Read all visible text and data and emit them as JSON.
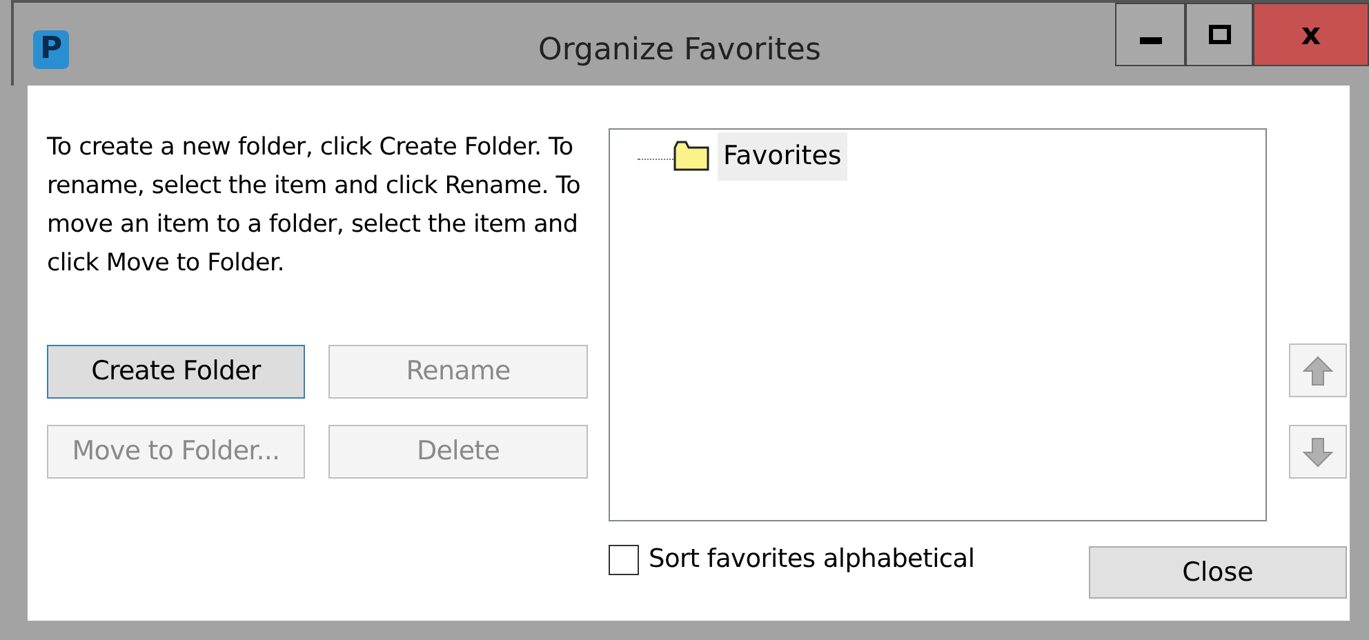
{
  "window": {
    "title": "Organize Favorites",
    "app_icon_letter": "P",
    "controls": [
      {
        "kind": "minimize"
      },
      {
        "kind": "maximize"
      },
      {
        "kind": "close",
        "label": "x"
      }
    ]
  },
  "instructions": "To create a new folder, click Create Folder. To rename, select the item and click Rename. To move an item to a folder, select the item and click Move to Folder.",
  "buttons": [
    {
      "label": "Create Folder",
      "disabled": false,
      "focused": true
    },
    {
      "label": "Rename",
      "disabled": true,
      "focused": false
    },
    {
      "label": "Move to Folder...",
      "disabled": true,
      "focused": false
    },
    {
      "label": "Delete",
      "disabled": true,
      "focused": false
    }
  ],
  "tree": [
    {
      "label": "Favorites",
      "selected": true
    }
  ],
  "move_buttons": [
    {
      "kind": "up",
      "disabled": true
    },
    {
      "kind": "down",
      "disabled": true
    }
  ],
  "sort_checkbox": {
    "label": "Sort favorites alphabetical",
    "checked": false
  },
  "close_button": {
    "label": "Close"
  }
}
